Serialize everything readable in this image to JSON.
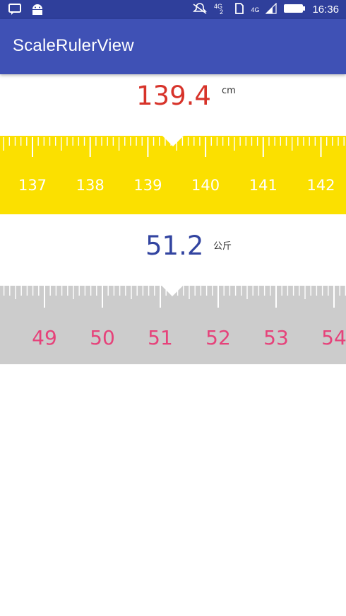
{
  "status_bar": {
    "time": "16:36",
    "network_label": "4G",
    "icons": [
      "message-icon",
      "android-icon",
      "mute-icon",
      "signal-4g-icon",
      "sim-icon",
      "cellular-icon",
      "battery-icon"
    ]
  },
  "app_bar": {
    "title": "ScaleRulerView"
  },
  "height_ruler": {
    "value": "139.4",
    "unit": "cm",
    "value_color": "#d7332a",
    "ruler_color": "#fbe000",
    "label_color": "#ffffff",
    "labels": [
      "137",
      "138",
      "139",
      "140",
      "141",
      "142"
    ],
    "current": 139.4
  },
  "weight_ruler": {
    "value": "51.2",
    "unit": "公斤",
    "value_color": "#3244a0",
    "ruler_color": "#cccccc",
    "label_color": "#e6427a",
    "labels": [
      "49",
      "50",
      "51",
      "52",
      "53",
      "54"
    ],
    "current": 51.2
  }
}
